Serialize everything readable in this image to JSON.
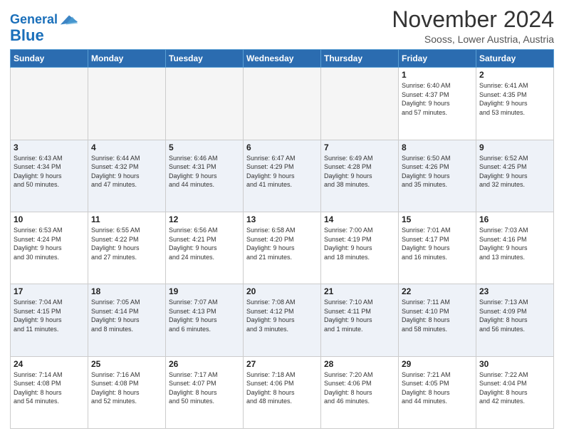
{
  "header": {
    "logo_line1": "General",
    "logo_line2": "Blue",
    "month": "November 2024",
    "location": "Sooss, Lower Austria, Austria"
  },
  "weekdays": [
    "Sunday",
    "Monday",
    "Tuesday",
    "Wednesday",
    "Thursday",
    "Friday",
    "Saturday"
  ],
  "weeks": [
    [
      {
        "day": "",
        "info": ""
      },
      {
        "day": "",
        "info": ""
      },
      {
        "day": "",
        "info": ""
      },
      {
        "day": "",
        "info": ""
      },
      {
        "day": "",
        "info": ""
      },
      {
        "day": "1",
        "info": "Sunrise: 6:40 AM\nSunset: 4:37 PM\nDaylight: 9 hours\nand 57 minutes."
      },
      {
        "day": "2",
        "info": "Sunrise: 6:41 AM\nSunset: 4:35 PM\nDaylight: 9 hours\nand 53 minutes."
      }
    ],
    [
      {
        "day": "3",
        "info": "Sunrise: 6:43 AM\nSunset: 4:34 PM\nDaylight: 9 hours\nand 50 minutes."
      },
      {
        "day": "4",
        "info": "Sunrise: 6:44 AM\nSunset: 4:32 PM\nDaylight: 9 hours\nand 47 minutes."
      },
      {
        "day": "5",
        "info": "Sunrise: 6:46 AM\nSunset: 4:31 PM\nDaylight: 9 hours\nand 44 minutes."
      },
      {
        "day": "6",
        "info": "Sunrise: 6:47 AM\nSunset: 4:29 PM\nDaylight: 9 hours\nand 41 minutes."
      },
      {
        "day": "7",
        "info": "Sunrise: 6:49 AM\nSunset: 4:28 PM\nDaylight: 9 hours\nand 38 minutes."
      },
      {
        "day": "8",
        "info": "Sunrise: 6:50 AM\nSunset: 4:26 PM\nDaylight: 9 hours\nand 35 minutes."
      },
      {
        "day": "9",
        "info": "Sunrise: 6:52 AM\nSunset: 4:25 PM\nDaylight: 9 hours\nand 32 minutes."
      }
    ],
    [
      {
        "day": "10",
        "info": "Sunrise: 6:53 AM\nSunset: 4:24 PM\nDaylight: 9 hours\nand 30 minutes."
      },
      {
        "day": "11",
        "info": "Sunrise: 6:55 AM\nSunset: 4:22 PM\nDaylight: 9 hours\nand 27 minutes."
      },
      {
        "day": "12",
        "info": "Sunrise: 6:56 AM\nSunset: 4:21 PM\nDaylight: 9 hours\nand 24 minutes."
      },
      {
        "day": "13",
        "info": "Sunrise: 6:58 AM\nSunset: 4:20 PM\nDaylight: 9 hours\nand 21 minutes."
      },
      {
        "day": "14",
        "info": "Sunrise: 7:00 AM\nSunset: 4:19 PM\nDaylight: 9 hours\nand 18 minutes."
      },
      {
        "day": "15",
        "info": "Sunrise: 7:01 AM\nSunset: 4:17 PM\nDaylight: 9 hours\nand 16 minutes."
      },
      {
        "day": "16",
        "info": "Sunrise: 7:03 AM\nSunset: 4:16 PM\nDaylight: 9 hours\nand 13 minutes."
      }
    ],
    [
      {
        "day": "17",
        "info": "Sunrise: 7:04 AM\nSunset: 4:15 PM\nDaylight: 9 hours\nand 11 minutes."
      },
      {
        "day": "18",
        "info": "Sunrise: 7:05 AM\nSunset: 4:14 PM\nDaylight: 9 hours\nand 8 minutes."
      },
      {
        "day": "19",
        "info": "Sunrise: 7:07 AM\nSunset: 4:13 PM\nDaylight: 9 hours\nand 6 minutes."
      },
      {
        "day": "20",
        "info": "Sunrise: 7:08 AM\nSunset: 4:12 PM\nDaylight: 9 hours\nand 3 minutes."
      },
      {
        "day": "21",
        "info": "Sunrise: 7:10 AM\nSunset: 4:11 PM\nDaylight: 9 hours\nand 1 minute."
      },
      {
        "day": "22",
        "info": "Sunrise: 7:11 AM\nSunset: 4:10 PM\nDaylight: 8 hours\nand 58 minutes."
      },
      {
        "day": "23",
        "info": "Sunrise: 7:13 AM\nSunset: 4:09 PM\nDaylight: 8 hours\nand 56 minutes."
      }
    ],
    [
      {
        "day": "24",
        "info": "Sunrise: 7:14 AM\nSunset: 4:08 PM\nDaylight: 8 hours\nand 54 minutes."
      },
      {
        "day": "25",
        "info": "Sunrise: 7:16 AM\nSunset: 4:08 PM\nDaylight: 8 hours\nand 52 minutes."
      },
      {
        "day": "26",
        "info": "Sunrise: 7:17 AM\nSunset: 4:07 PM\nDaylight: 8 hours\nand 50 minutes."
      },
      {
        "day": "27",
        "info": "Sunrise: 7:18 AM\nSunset: 4:06 PM\nDaylight: 8 hours\nand 48 minutes."
      },
      {
        "day": "28",
        "info": "Sunrise: 7:20 AM\nSunset: 4:06 PM\nDaylight: 8 hours\nand 46 minutes."
      },
      {
        "day": "29",
        "info": "Sunrise: 7:21 AM\nSunset: 4:05 PM\nDaylight: 8 hours\nand 44 minutes."
      },
      {
        "day": "30",
        "info": "Sunrise: 7:22 AM\nSunset: 4:04 PM\nDaylight: 8 hours\nand 42 minutes."
      }
    ]
  ]
}
